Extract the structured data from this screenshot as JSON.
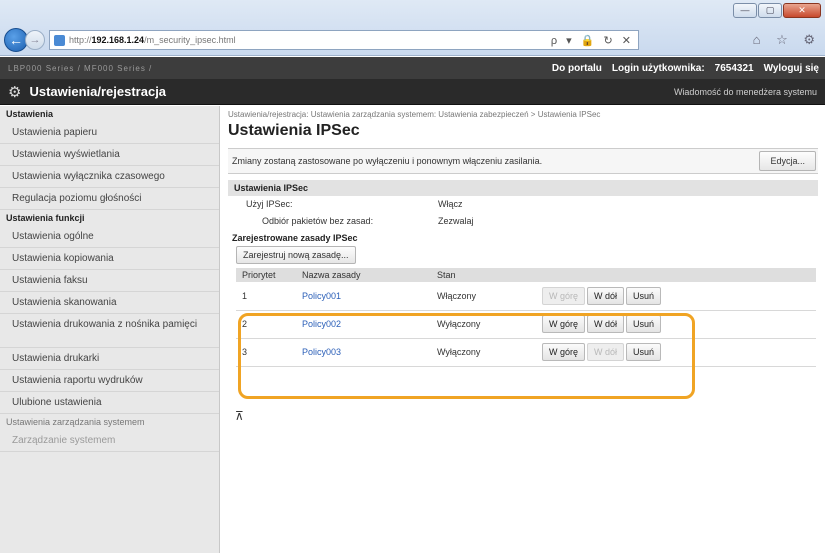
{
  "browser": {
    "url_prefix": "http://",
    "url_host": "192.168.1.24",
    "url_path": "/m_security_ipsec.html",
    "toolbar_glyphs": "ρ ▾ 🔒 ↻ ✕",
    "right_glyphs": "⌂ ☆ ⚙"
  },
  "topbar": {
    "device_name": "LBP000 Series / MF000 Series /",
    "to_portal": "Do portalu",
    "login_label": "Login użytkownika:",
    "login_id": "7654321",
    "logout": "Wyloguj się"
  },
  "header": {
    "title": "Ustawienia/rejestracja",
    "mail_admin": "Wiadomość do menedżera systemu"
  },
  "sidebar": {
    "group1": "Ustawienia",
    "items1": [
      "Ustawienia papieru",
      "Ustawienia wyświetlania",
      "Ustawienia wyłącznika czasowego",
      "Regulacja poziomu głośności"
    ],
    "group2": "Ustawienia funkcji",
    "items2": [
      "Ustawienia ogólne",
      "Ustawienia kopiowania",
      "Ustawienia faksu",
      "Ustawienia skanowania",
      "Ustawienia drukowania z nośnika pamięci",
      "Ustawienia drukarki",
      "Ustawienia raportu wydruków",
      "Ulubione ustawienia"
    ],
    "group3": "Ustawienia zarządzania systemem",
    "item3": "Zarządzanie systemem"
  },
  "main": {
    "breadcrumb": "Ustawienia/rejestracja: Ustawienia zarządzania systemem: Ustawienia zabezpieczeń > Ustawienia IPSec",
    "title": "Ustawienia IPSec",
    "notice": "Zmiany zostaną zastosowane po wyłączeniu i ponownym włączeniu zasilania.",
    "edit_label": "Edycja...",
    "section_title": "Ustawienia IPSec",
    "use_ipsec_label": "Użyj IPSec:",
    "use_ipsec_value": "Włącz",
    "receive_label": "Odbiór pakietów bez zasad:",
    "receive_value": "Zezwalaj",
    "registered_title": "Zarejestrowane zasady IPSec",
    "register_btn": "Zarejestruj nową zasadę...",
    "columns": [
      "Priorytet",
      "Nazwa zasady",
      "Stan"
    ],
    "btn_up": "W górę",
    "btn_down": "W dół",
    "btn_delete": "Usuń",
    "rows": [
      {
        "priority": "1",
        "name": "Policy001",
        "state": "Włączony"
      },
      {
        "priority": "2",
        "name": "Policy002",
        "state": "Wyłączony"
      },
      {
        "priority": "3",
        "name": "Policy003",
        "state": "Wyłączony"
      }
    ],
    "top_glyph": "⊼"
  }
}
